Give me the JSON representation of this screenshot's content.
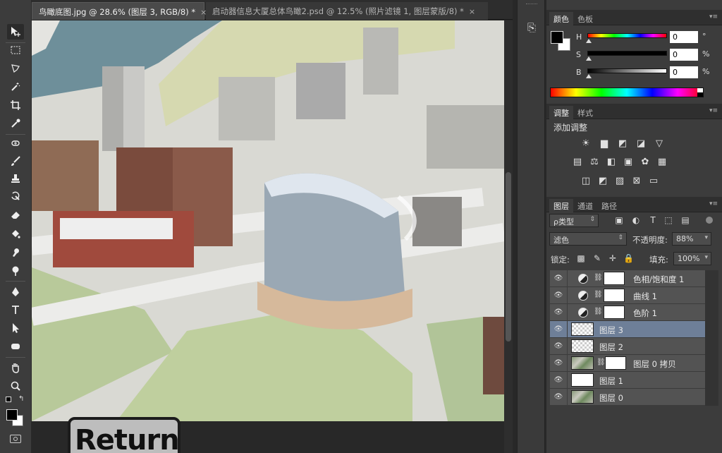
{
  "document_tabs": [
    {
      "title": "鸟瞰底图.jpg @ 28.6% (图层 3, RGB/8) *",
      "close": "×",
      "active": true
    },
    {
      "title": "启动器信息大厦总体鸟瞰2.psd @ 12.5% (照片滤镜 1, 图层蒙版/8) *",
      "close": "×",
      "active": false
    }
  ],
  "overlay": {
    "return_label": "Return"
  },
  "color_panel": {
    "tabs": [
      "颜色",
      "色板"
    ],
    "foreground": "#000000",
    "background": "#ffffff",
    "sliders": [
      {
        "label": "H",
        "value": "0",
        "unit": "°"
      },
      {
        "label": "S",
        "value": "0",
        "unit": "%"
      },
      {
        "label": "B",
        "value": "0",
        "unit": "%"
      }
    ]
  },
  "adjustments_panel": {
    "tabs": [
      "调整",
      "样式"
    ],
    "title": "添加调整"
  },
  "layers_panel": {
    "tabs": [
      "图层",
      "通道",
      "路径"
    ],
    "filter_type": "ρ类型",
    "blend_mode": "滤色",
    "opacity_label": "不透明度:",
    "opacity_value": "88%",
    "lock_label": "锁定:",
    "fill_label": "填充:",
    "fill_value": "100%",
    "layers": [
      {
        "name": "色相/饱和度 1",
        "kind": "adjustment",
        "selected": false
      },
      {
        "name": "曲线 1",
        "kind": "adjustment",
        "selected": false
      },
      {
        "name": "色阶 1",
        "kind": "adjustment",
        "selected": false
      },
      {
        "name": "图层 3",
        "kind": "transparent",
        "selected": true
      },
      {
        "name": "图层 2",
        "kind": "transparent",
        "selected": false
      },
      {
        "name": "图层 0 拷贝",
        "kind": "photo-mask",
        "selected": false
      },
      {
        "name": "图层 1",
        "kind": "white",
        "selected": false
      },
      {
        "name": "图层 0",
        "kind": "photo",
        "selected": false
      }
    ]
  },
  "colors": {
    "selected_layer": "#6e7f98",
    "panel_bg": "#3c3c3c"
  }
}
